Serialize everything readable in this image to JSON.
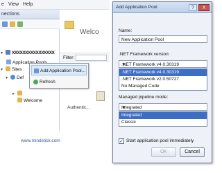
{
  "iis": {
    "menu": [
      "e",
      "View",
      "Help"
    ],
    "connections_title": "nections",
    "tree": {
      "server": "XXXXXXXXXXXXXXXX",
      "app_pools": "Application Pools",
      "sites": "Sites",
      "default_site": "Def",
      "child1": "",
      "welcome": "Welcome"
    },
    "work_title": "Welco",
    "filter_label": "Filter:",
    "work_column": "Authentic..."
  },
  "context_menu": {
    "items": [
      {
        "label": "Add Application Pool...",
        "icon": "add-app-pool-icon"
      },
      {
        "label": "Refresh",
        "icon": "refresh-icon"
      }
    ]
  },
  "caption": "www.mindstick.com",
  "dialog": {
    "title": "Add Application Pool",
    "help": "?",
    "close": "X",
    "name_label": "Name:",
    "name_value": "New Application Pool",
    "framework_label": ".NET Framework version:",
    "framework_selected": ".NET Framework v4.0.30319",
    "framework_options": [
      ".NET Framework v4.0.30319",
      ".NET Framework v2.0.50727",
      "No Managed Code"
    ],
    "pipeline_label": "Managed pipeline mode:",
    "pipeline_selected": "Integrated",
    "pipeline_options": [
      "Integrated",
      "Classic"
    ],
    "start_label": "Start application pool immediately",
    "start_checked": true,
    "ok_label": "OK",
    "cancel_label": "Cancel"
  },
  "colors": {
    "selection": "#3d6ec7",
    "titlebar": "#bcd1ec",
    "close_button": "#c75050",
    "link": "#3a56a8"
  }
}
